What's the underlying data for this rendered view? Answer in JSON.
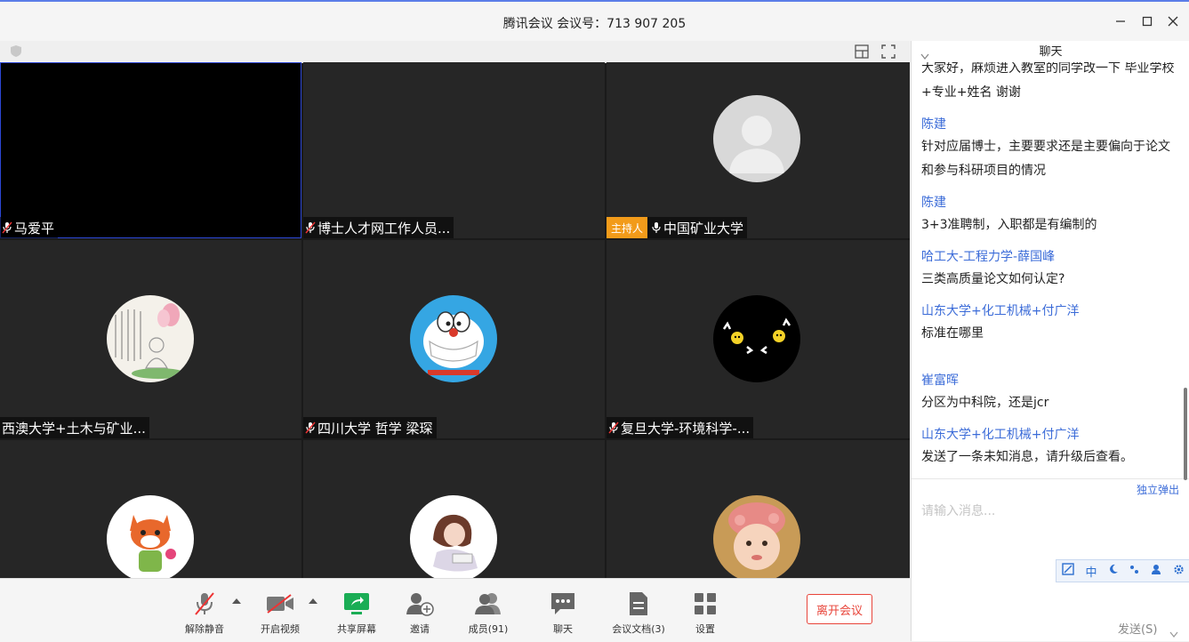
{
  "window": {
    "title": "腾讯会议 会议号：713 907 205"
  },
  "tiles": [
    {
      "name": "马爱平",
      "muted": true,
      "host": false,
      "avatar": "none"
    },
    {
      "name": "博士人才网工作人员...",
      "muted": true,
      "host": false,
      "avatar": "none"
    },
    {
      "name": "中国矿业大学",
      "muted": false,
      "host": true,
      "host_label": "主持人",
      "avatar": "default-person-avatar"
    },
    {
      "name": "西澳大学+土木与矿业...",
      "muted": false,
      "host": false,
      "avatar": "lotus-drawing-avatar"
    },
    {
      "name": "四川大学 哲学 梁琛",
      "muted": true,
      "host": false,
      "avatar": "doraemon-avatar"
    },
    {
      "name": "复旦大学-环境科学-...",
      "muted": true,
      "host": false,
      "avatar": "smiley-hands-avatar"
    },
    {
      "name": "",
      "muted": false,
      "host": false,
      "avatar": "fox-cartoon-avatar"
    },
    {
      "name": "",
      "muted": false,
      "host": false,
      "avatar": "girl-drawing-avatar"
    },
    {
      "name": "",
      "muted": false,
      "host": false,
      "avatar": "baby-photo-avatar"
    }
  ],
  "toolbar": {
    "unmute": "解除静音",
    "start_video": "开启视频",
    "share_screen": "共享屏幕",
    "invite": "邀请",
    "members": "成员(91)",
    "chat": "聊天",
    "docs": "会议文档(3)",
    "settings": "设置",
    "leave": "离开会议"
  },
  "chat": {
    "title": "聊天",
    "messages": [
      {
        "sender": "",
        "text": "大家好，麻烦进入教室的同学改一下 毕业学校+专业+姓名 谢谢"
      },
      {
        "sender": "陈建",
        "text": "针对应届博士，主要要求还是主要偏向于论文和参与科研项目的情况"
      },
      {
        "sender": "陈建",
        "text": "3+3准聘制，入职都是有编制的"
      },
      {
        "sender": "哈工大-工程力学-薛国峰",
        "text": "三类高质量论文如何认定?"
      },
      {
        "sender": "山东大学+化工机械+付广洋",
        "text": "标准在哪里"
      },
      {
        "sender": "崔富晖",
        "text": "分区为中科院，还是jcr"
      },
      {
        "sender": "山东大学+化工机械+付广洋",
        "text": "发送了一条未知消息，请升级后查看。"
      }
    ],
    "popout": "独立弹出",
    "input_placeholder": "请输入消息...",
    "ime_mode": "中",
    "send": "发送(S)"
  },
  "colors": {
    "accent": "#3c6cd8",
    "leave": "#e8443a",
    "host_badge": "#f29b1a",
    "share_green": "#1aad55"
  }
}
